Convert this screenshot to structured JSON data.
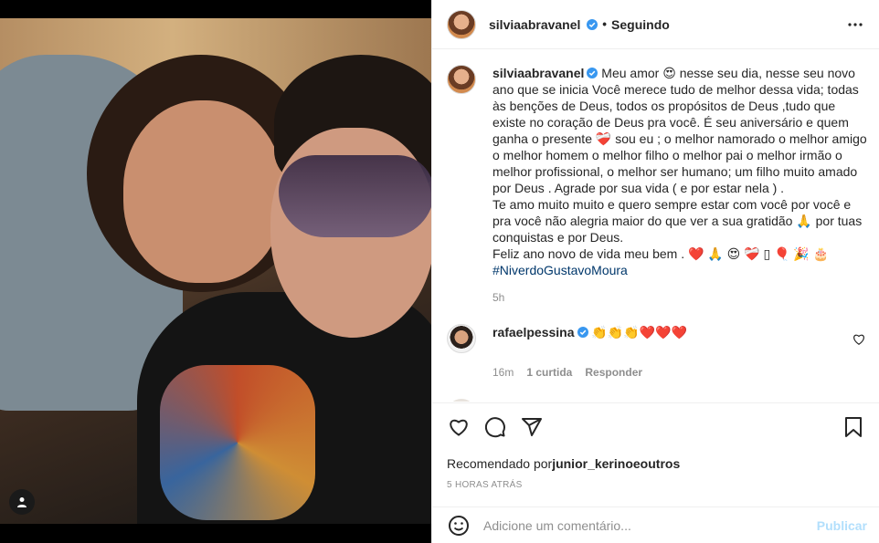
{
  "post": {
    "username": "silviaabravanel",
    "follow_status": "Seguindo",
    "separator": "•"
  },
  "caption": {
    "username": "silviaabravanel",
    "text": "Meu amor 😍 nesse seu dia, nesse seu novo ano que se inicia Você merece tudo de melhor dessa vida; todas às benções de Deus, todos os propósitos de Deus ,tudo que existe no coração de Deus pra você. É seu aniversário e quem ganha o presente ❤️‍🩹 sou eu ; o melhor namorado o melhor amigo o melhor homem o melhor filho o melhor pai o melhor irmão o melhor profissional, o melhor ser humano; um filho muito amado por Deus . Agrade por sua vida ( e por estar nela ) .\nTe amo muito muito e quero sempre estar com você por você e pra você não alegria maior do que ver a sua gratidão 🙏 por tuas conquistas e por Deus.\nFeliz ano novo de vida meu bem . ❤️ 🙏 😍 ❤️‍🩹 ▯ 🎈 🎉 🎂",
    "hashtag": "#NiverdoGustavoMoura",
    "time": "5h"
  },
  "comments": [
    {
      "username": "rafaelpessina",
      "text": "👏👏👏❤️❤️❤️",
      "time": "16m",
      "likes": "1 curtida",
      "reply_label": "Responder"
    }
  ],
  "recommended": {
    "prefix": "Recomendado por",
    "user": "junior_kerino",
    "suffix": "e",
    "others": "outros"
  },
  "timestamp": "5 HORAS ATRÁS",
  "add_comment": {
    "placeholder": "Adicione um comentário...",
    "publish_label": "Publicar"
  },
  "colors": {
    "verified": "#3897f0",
    "link": "#00376b",
    "publish_disabled": "#b2dffc",
    "muted": "#8e8e8e"
  },
  "icons": [
    "more-options-icon",
    "verified-icon",
    "heart-icon",
    "comment-icon",
    "share-icon",
    "bookmark-icon",
    "emoji-icon",
    "user-tag-icon"
  ]
}
